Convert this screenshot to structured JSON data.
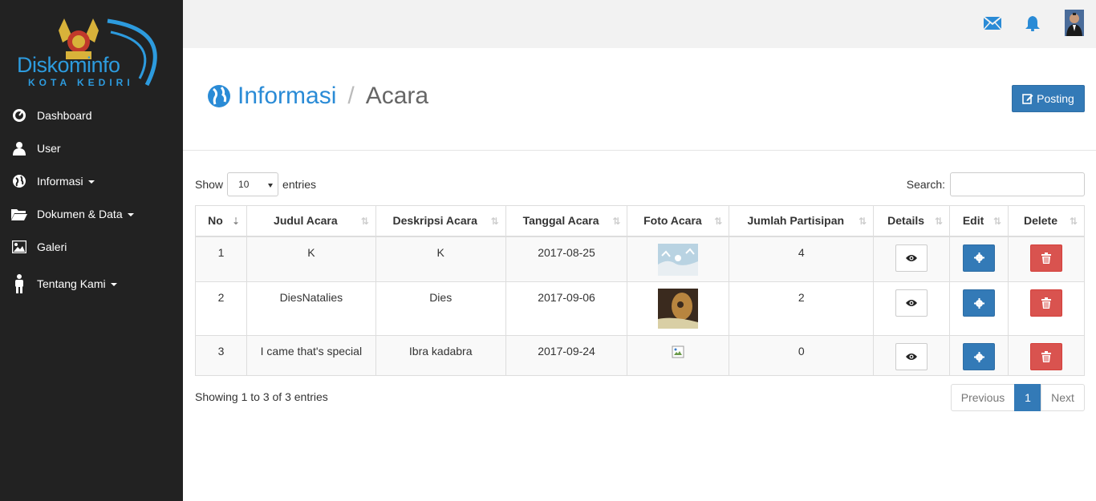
{
  "brand": {
    "logo_text": "Diskominfo",
    "logo_sub": "KOTA KEDIRI"
  },
  "sidebar": {
    "items": [
      {
        "label": "Dashboard",
        "icon": "dashboard-icon",
        "caret": false
      },
      {
        "label": "User",
        "icon": "user-icon",
        "caret": false
      },
      {
        "label": "Informasi",
        "icon": "globe-icon",
        "caret": true
      },
      {
        "label": "Dokumen & Data",
        "icon": "folder-icon",
        "caret": true
      },
      {
        "label": "Galeri",
        "icon": "picture-icon",
        "caret": false
      },
      {
        "label": "Tentang Kami",
        "icon": "person-icon",
        "caret": true
      }
    ]
  },
  "header": {
    "breadcrumb_home": "Informasi",
    "breadcrumb_current": "Acara",
    "posting_label": "Posting"
  },
  "table_controls": {
    "show_label": "Show",
    "entries_value": "10",
    "entries_label": "entries",
    "search_label": "Search:"
  },
  "table": {
    "columns": [
      "No",
      "Judul Acara",
      "Deskripsi Acara",
      "Tanggal Acara",
      "Foto Acara",
      "Jumlah Partisipan",
      "Details",
      "Edit",
      "Delete"
    ],
    "rows": [
      {
        "no": "1",
        "judul": "K",
        "deskripsi": "K",
        "tanggal": "2017-08-25",
        "foto": "snow-photo",
        "partisipan": "4"
      },
      {
        "no": "2",
        "judul": "DiesNatalies",
        "deskripsi": "Dies",
        "tanggal": "2017-09-06",
        "foto": "guitar-photo",
        "partisipan": "2"
      },
      {
        "no": "3",
        "judul": "I came that's special",
        "deskripsi": "Ibra kadabra",
        "tanggal": "2017-09-24",
        "foto": "broken-image",
        "partisipan": "0"
      }
    ]
  },
  "footer": {
    "info": "Showing 1 to 3 of 3 entries",
    "prev": "Previous",
    "page": "1",
    "next": "Next"
  },
  "colors": {
    "sidebar_bg": "#222222",
    "primary": "#337ab7",
    "danger": "#d9534f",
    "link": "#2a8bd6"
  }
}
